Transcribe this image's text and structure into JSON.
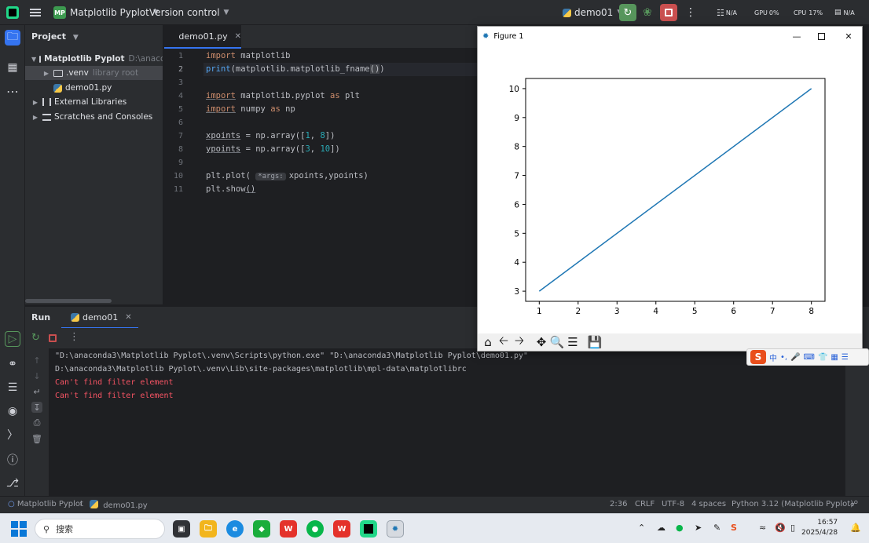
{
  "titlebar": {
    "project_badge": "MP",
    "project_name": "Matplotlib Pyplot",
    "vcs": "Version control",
    "run_config": "demo01",
    "net_label": "N/A",
    "gpu_label": "GPU",
    "gpu_value": "0%",
    "cpu_label": "CPU",
    "cpu_value": "17%",
    "mem_label": "N/A"
  },
  "project_panel": {
    "header": "Project",
    "tree": [
      {
        "label": "Matplotlib Pyplot",
        "hint": "D:\\anaconda",
        "type": "folder",
        "expanded": true,
        "level": 0,
        "selected": false
      },
      {
        "label": ".venv",
        "hint": "library root",
        "type": "folder",
        "expanded": false,
        "level": 1,
        "selected": true
      },
      {
        "label": "demo01.py",
        "hint": "",
        "type": "py",
        "level": 1,
        "selected": false
      },
      {
        "label": "External Libraries",
        "hint": "",
        "type": "lib",
        "level": 0,
        "selected": false
      },
      {
        "label": "Scratches and Consoles",
        "hint": "",
        "type": "scratch",
        "level": 0,
        "selected": false
      }
    ]
  },
  "editor": {
    "tab": "demo01.py",
    "line_numbers": [
      "1",
      "2",
      "3",
      "4",
      "5",
      "6",
      "7",
      "8",
      "9",
      "10",
      "11"
    ],
    "inlay_hint": "*args:"
  },
  "figure": {
    "window_title": "Figure 1",
    "toolbar": [
      "home-icon",
      "back-icon",
      "forward-icon",
      "pan-icon",
      "zoom-icon",
      "configure-icon",
      "save-icon"
    ]
  },
  "chart_data": {
    "type": "line",
    "x": [
      1,
      8
    ],
    "series": [
      {
        "values": [
          3,
          10
        ]
      }
    ],
    "title": "",
    "xlabel": "",
    "ylabel": "",
    "xlim": [
      0.65,
      8.35
    ],
    "ylim": [
      2.65,
      10.35
    ],
    "xticks": [
      "1",
      "2",
      "3",
      "4",
      "5",
      "6",
      "7",
      "8"
    ],
    "yticks": [
      "3",
      "4",
      "5",
      "6",
      "7",
      "8",
      "9",
      "10"
    ],
    "grid": false,
    "line_color": "#1f77b4"
  },
  "run": {
    "title": "Run",
    "tab": "demo01",
    "output": [
      {
        "text": "\"D:\\anaconda3\\Matplotlib Pyplot\\.venv\\Scripts\\python.exe\" \"D:\\anaconda3\\Matplotlib Pyplot\\demo01.py\"",
        "kind": "norm"
      },
      {
        "text": "D:\\anaconda3\\Matplotlib Pyplot\\.venv\\Lib\\site-packages\\matplotlib\\mpl-data\\matplotlibrc",
        "kind": "norm"
      },
      {
        "text": "Can't find filter element",
        "kind": "err"
      },
      {
        "text": "Can't find filter element",
        "kind": "err"
      }
    ]
  },
  "statusbar": {
    "project": "Matplotlib Pyplot",
    "file": "demo01.py",
    "position": "2:36",
    "line_sep": "CRLF",
    "encoding": "UTF-8",
    "indent": "4 spaces",
    "interpreter": "Python 3.12 (Matplotlib Pyplot)"
  },
  "taskbar": {
    "search_placeholder": "搜索",
    "time": "16:57",
    "date": "2025/4/28"
  },
  "ime": {
    "lang": "中"
  },
  "colors": {
    "accent": "#3574f0",
    "run_green": "#57965c",
    "stop_red": "#c94f4f",
    "error_text": "#f75464"
  }
}
